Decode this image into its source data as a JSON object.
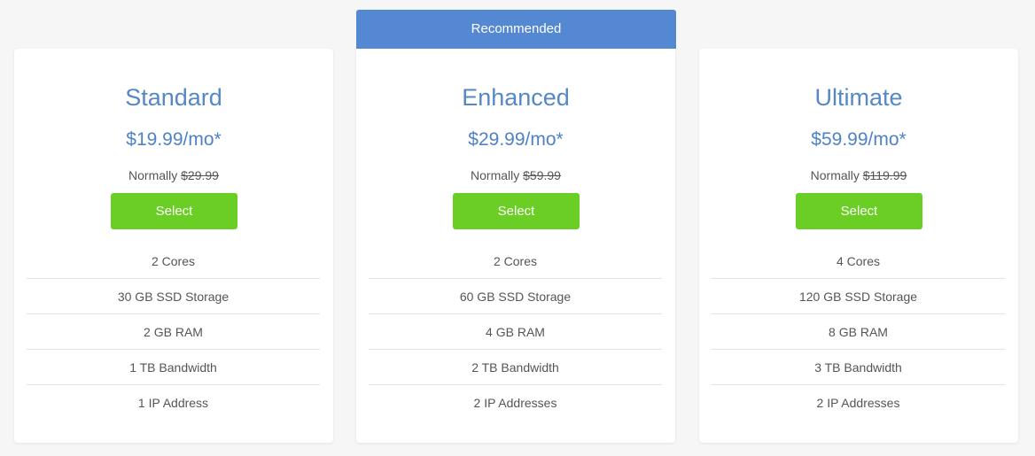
{
  "banner": {
    "label": "Recommended"
  },
  "plans": [
    {
      "name": "Standard",
      "price": "$19.99/mo*",
      "normally_label": "Normally",
      "normally_price": "$29.99",
      "button_label": "Select",
      "features": [
        "2 Cores",
        "30 GB SSD Storage",
        "2 GB RAM",
        "1 TB Bandwidth",
        "1 IP Address"
      ]
    },
    {
      "name": "Enhanced",
      "price": "$29.99/mo*",
      "normally_label": "Normally",
      "normally_price": "$59.99",
      "button_label": "Select",
      "features": [
        "2 Cores",
        "60 GB SSD Storage",
        "4 GB RAM",
        "2 TB Bandwidth",
        "2 IP Addresses"
      ]
    },
    {
      "name": "Ultimate",
      "price": "$59.99/mo*",
      "normally_label": "Normally",
      "normally_price": "$119.99",
      "button_label": "Select",
      "features": [
        "4 Cores",
        "120 GB SSD Storage",
        "8 GB RAM",
        "3 TB Bandwidth",
        "2 IP Addresses"
      ]
    }
  ],
  "colors": {
    "accent": "#5588d3",
    "title_text": "#5588c5",
    "button": "#6ace24",
    "background": "#f6f6f6"
  }
}
